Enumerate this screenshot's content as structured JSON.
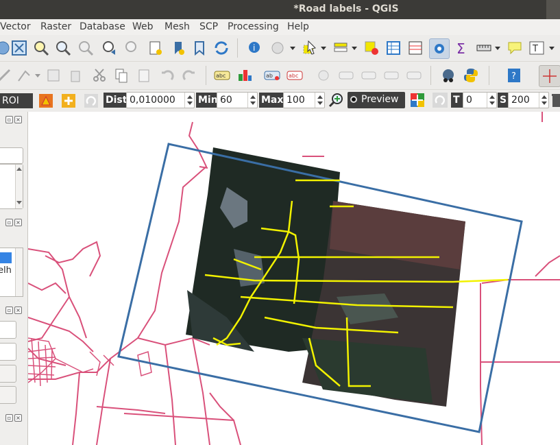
{
  "window": {
    "title": "*Road labels - QGIS"
  },
  "menubar": {
    "items": [
      "Vector",
      "Raster",
      "Database",
      "Web",
      "Mesh",
      "SCP",
      "Processing",
      "Help"
    ]
  },
  "scp_toolbar": {
    "roi_label": "ROI",
    "dist_label": "Dist",
    "dist_value": "0,010000",
    "min_label": "Min",
    "min_value": "60",
    "max_label": "Max",
    "max_value": "100",
    "preview_label": "Preview",
    "t_label": "T",
    "t_value": "0",
    "s_label": "S",
    "s_value": "200"
  },
  "left_panel": {
    "partial_text": "elh"
  },
  "colors": {
    "roads_layer": "#d9507a",
    "extent_rectangle": "#3a6ea5",
    "labelled_roads": "#f2f200",
    "titlebar": "#3b3a37",
    "toolbar_bg": "#edecea"
  },
  "icons": {
    "toolbar_row1": [
      "pan-icon",
      "zoom-full-icon",
      "zoom-in-icon",
      "zoom-out-icon",
      "zoom-native-icon",
      "zoom-last-icon",
      "zoom-next-icon",
      "new-bookmark-icon",
      "show-bookmarks-icon",
      "refresh-icon",
      "identify-icon",
      "action-icon",
      "select-icon",
      "attribute-table-icon",
      "statistics-icon",
      "sum-icon",
      "measure-icon",
      "map-tips-icon",
      "text-annotation-icon"
    ],
    "toolbar_row2": [
      "digitize-icon",
      "add-feature-icon",
      "delete-icon",
      "cut-icon",
      "copy-icon",
      "paste-icon",
      "undo-icon",
      "redo-icon",
      "label-icon",
      "diagram-icon",
      "pin-label-icon",
      "show-label-icon",
      "python-icon",
      "help-icon",
      "crosshair-icon"
    ]
  }
}
